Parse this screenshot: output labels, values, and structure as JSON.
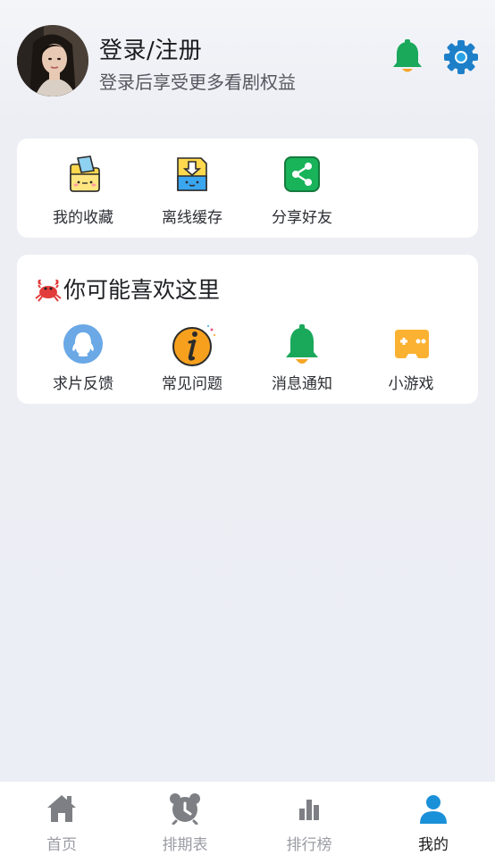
{
  "header": {
    "login_title": "登录/注册",
    "login_subtitle": "登录后享受更多看剧权益",
    "bell_icon": "bell-icon",
    "settings_icon": "gear-icon"
  },
  "quick_actions": [
    {
      "label": "我的收藏",
      "icon": "folder-favorite-icon"
    },
    {
      "label": "离线缓存",
      "icon": "download-cache-icon"
    },
    {
      "label": "分享好友",
      "icon": "share-icon"
    }
  ],
  "recommend": {
    "title": "你可能喜欢这里",
    "title_icon": "crab-icon",
    "items": [
      {
        "label": "求片反馈",
        "icon": "qq-penguin-icon"
      },
      {
        "label": "常见问题",
        "icon": "info-icon"
      },
      {
        "label": "消息通知",
        "icon": "bell-icon"
      },
      {
        "label": "小游戏",
        "icon": "gamepad-icon"
      }
    ]
  },
  "bottom_nav": {
    "items": [
      {
        "label": "首页",
        "icon": "home-icon",
        "active": false
      },
      {
        "label": "排期表",
        "icon": "alarm-clock-icon",
        "active": false
      },
      {
        "label": "排行榜",
        "icon": "bar-chart-icon",
        "active": false
      },
      {
        "label": "我的",
        "icon": "user-icon",
        "active": true
      }
    ]
  },
  "colors": {
    "accent_green": "#1aa85b",
    "accent_blue": "#1e8bd6",
    "active_tab_icon": "#1a90d9",
    "inactive_tab": "#9a9ca3"
  }
}
